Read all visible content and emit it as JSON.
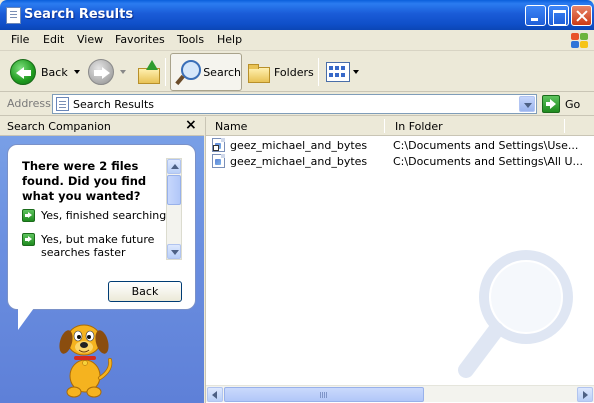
{
  "window": {
    "title": "Search Results"
  },
  "menu": [
    "File",
    "Edit",
    "View",
    "Favorites",
    "Tools",
    "Help"
  ],
  "toolbar": {
    "back_label": "Back",
    "search_label": "Search",
    "folders_label": "Folders"
  },
  "address": {
    "label": "Address",
    "value": "Search Results",
    "go_label": "Go"
  },
  "companion": {
    "title": "Search Companion",
    "question": "There were 2 files found. Did you find what you wanted?",
    "options": [
      "Yes, finished searching",
      "Yes, but make future searches faster"
    ],
    "back_label": "Back"
  },
  "results": {
    "columns": [
      "Name",
      "In Folder"
    ],
    "rows": [
      {
        "name": "geez_michael_and_bytes",
        "folder": "C:\\Documents and Settings\\Use..."
      },
      {
        "name": "geez_michael_and_bytes",
        "folder": "C:\\Documents and Settings\\All U..."
      }
    ]
  },
  "colors": {
    "titlebar": "#0F4FC9",
    "companion_bg": "#6b8fe0",
    "chrome": "#ECE9D8"
  }
}
